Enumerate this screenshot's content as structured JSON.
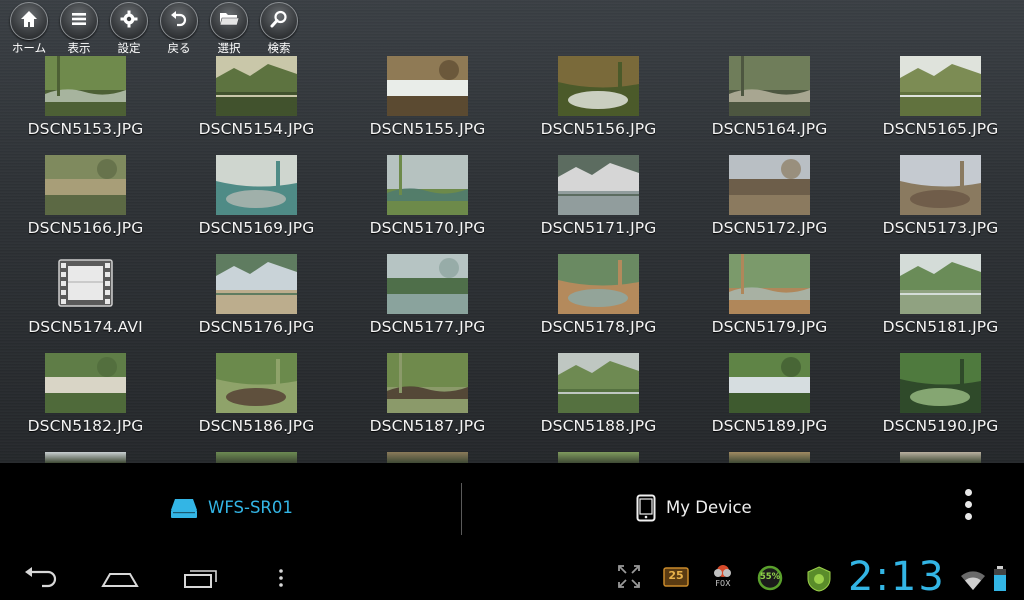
{
  "toolbar": [
    {
      "label": "ホーム",
      "icon": "home-icon"
    },
    {
      "label": "表示",
      "icon": "list-icon"
    },
    {
      "label": "設定",
      "icon": "gear-icon"
    },
    {
      "label": "戻る",
      "icon": "back-arrow-icon"
    },
    {
      "label": "選択",
      "icon": "folder-icon"
    },
    {
      "label": "検索",
      "icon": "magnifier-icon"
    }
  ],
  "files": [
    {
      "name": "DSCN5153.JPG",
      "kind": "image",
      "palette": [
        "#6f8a4c",
        "#b7c3b0",
        "#4d6035"
      ]
    },
    {
      "name": "DSCN5154.JPG",
      "kind": "image",
      "palette": [
        "#5d7340",
        "#c9c7a9",
        "#3b4a28"
      ]
    },
    {
      "name": "DSCN5155.JPG",
      "kind": "image",
      "palette": [
        "#8f7a55",
        "#e9ede9",
        "#5b4a31"
      ]
    },
    {
      "name": "DSCN5156.JPG",
      "kind": "image",
      "palette": [
        "#7a6a3a",
        "#d8dcd0",
        "#4b5a2a"
      ]
    },
    {
      "name": "DSCN5164.JPG",
      "kind": "image",
      "palette": [
        "#6f7d5a",
        "#b8b4a0",
        "#4d5640"
      ]
    },
    {
      "name": "DSCN5165.JPG",
      "kind": "image",
      "palette": [
        "#7c8c54",
        "#dfe3dc",
        "#5a6b38"
      ]
    },
    {
      "name": "DSCN5166.JPG",
      "kind": "image",
      "palette": [
        "#7f8a5e",
        "#a89e78",
        "#5c6944"
      ]
    },
    {
      "name": "DSCN5169.JPG",
      "kind": "image",
      "palette": [
        "#cfd6cf",
        "#a9b4ae",
        "#4f8b86"
      ]
    },
    {
      "name": "DSCN5170.JPG",
      "kind": "image",
      "palette": [
        "#b6c2c0",
        "#4f7a70",
        "#6d8a4a"
      ]
    },
    {
      "name": "DSCN5171.JPG",
      "kind": "image",
      "palette": [
        "#d6d6d6",
        "#5c6c60",
        "#7f8e8e"
      ]
    },
    {
      "name": "DSCN5172.JPG",
      "kind": "image",
      "palette": [
        "#b9bfc4",
        "#6d5e4a",
        "#8b7a5f"
      ]
    },
    {
      "name": "DSCN5173.JPG",
      "kind": "image",
      "palette": [
        "#c5cad0",
        "#6d5a48",
        "#8a7a60"
      ]
    },
    {
      "name": "DSCN5174.AVI",
      "kind": "video",
      "palette": [
        "#ffffff",
        "#bdbdbd",
        "#444444"
      ]
    },
    {
      "name": "DSCN5176.JPG",
      "kind": "image",
      "palette": [
        "#c9d3d8",
        "#5f7c60",
        "#b9a47a"
      ]
    },
    {
      "name": "DSCN5177.JPG",
      "kind": "image",
      "palette": [
        "#b6c4c3",
        "#4f6f4a",
        "#8aa39d"
      ]
    },
    {
      "name": "DSCN5178.JPG",
      "kind": "image",
      "palette": [
        "#6a8a62",
        "#8fa6a0",
        "#b48a5c"
      ]
    },
    {
      "name": "DSCN5179.JPG",
      "kind": "image",
      "palette": [
        "#7b9a6b",
        "#a7b8b0",
        "#b0875a"
      ]
    },
    {
      "name": "DSCN5181.JPG",
      "kind": "image",
      "palette": [
        "#6a8c58",
        "#d4dcd8",
        "#9aa88c"
      ]
    },
    {
      "name": "DSCN5182.JPG",
      "kind": "image",
      "palette": [
        "#5f7d47",
        "#d9d5c6",
        "#4f6a3a"
      ]
    },
    {
      "name": "DSCN5186.JPG",
      "kind": "image",
      "palette": [
        "#6b8a4c",
        "#5a4738",
        "#8fa36a"
      ]
    },
    {
      "name": "DSCN5187.JPG",
      "kind": "image",
      "palette": [
        "#6f8a4c",
        "#4a3a2e",
        "#8b9a6a"
      ]
    },
    {
      "name": "DSCN5188.JPG",
      "kind": "image",
      "palette": [
        "#6e8a52",
        "#bfc7c2",
        "#4f6a3c"
      ]
    },
    {
      "name": "DSCN5189.JPG",
      "kind": "image",
      "palette": [
        "#5f8446",
        "#d6dde0",
        "#3e5a2f"
      ]
    },
    {
      "name": "DSCN5190.JPG",
      "kind": "image",
      "palette": [
        "#4f7a3e",
        "#8fb07a",
        "#2f4a2a"
      ]
    }
  ],
  "devices": {
    "active": {
      "label": "WFS-SR01",
      "icon": "storage-drive-icon"
    },
    "inactive": {
      "label": "My Device",
      "icon": "phone-icon"
    }
  },
  "status": {
    "clock": "2:13",
    "calendar_day": "25",
    "battery_percent": "55%",
    "weather_label": "F0X"
  },
  "colors": {
    "accent": "#33b5e5"
  }
}
